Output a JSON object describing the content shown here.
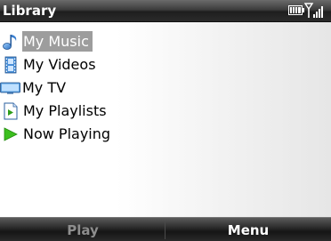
{
  "title_bar": {
    "title": "Library",
    "battery_icon": "battery-full-icon",
    "signal_icon": "signal-strength-icon"
  },
  "menu": {
    "items": [
      {
        "label": "My Music",
        "icon": "music-note-icon",
        "selected": true
      },
      {
        "label": "My Videos",
        "icon": "film-strip-icon",
        "selected": false
      },
      {
        "label": "My TV",
        "icon": "tv-icon",
        "selected": false
      },
      {
        "label": "My Playlists",
        "icon": "playlist-icon",
        "selected": false
      },
      {
        "label": "Now Playing",
        "icon": "play-arrow-icon",
        "selected": false
      }
    ]
  },
  "softkeys": {
    "left": "Play",
    "right": "Menu"
  },
  "colors": {
    "selection": "#9d9d9d",
    "now_playing_arrow": "#3cbf1e",
    "bar_dark": "#1e1e1e"
  }
}
